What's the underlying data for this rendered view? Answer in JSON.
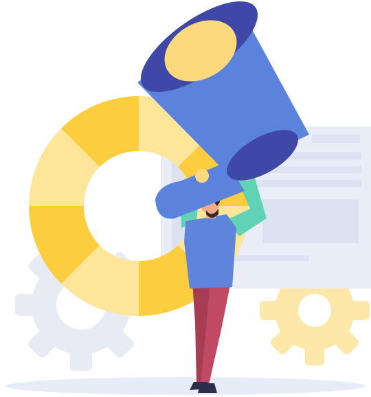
{
  "illustration": {
    "subject": "megaphone-marketing",
    "icons": [
      "gear-icon",
      "gear-icon",
      "donut-chart-icon",
      "document-panel-icon",
      "megaphone-icon",
      "person-icon"
    ]
  },
  "colors": {
    "background": "#ffffff",
    "gear_grey": "#e8ebf3",
    "gear_yellow": "#fde7a9",
    "panel_light": "#e9edf7",
    "panel_mid": "#dce2f1",
    "donut_dark": "#fccd3f",
    "donut_light": "#fde59a",
    "megaphone_blue": "#5b83dc",
    "megaphone_indigo": "#3f48a6",
    "megaphone_inner_yellow": "#fcd97c",
    "shirt_blue": "#5e84dc",
    "sleeve_green": "#5fd3b4",
    "pants_red": "#b8445d",
    "skin": "#f3ab8a",
    "hair": "#3a2a2a",
    "shadow": "#e8ecf7"
  }
}
